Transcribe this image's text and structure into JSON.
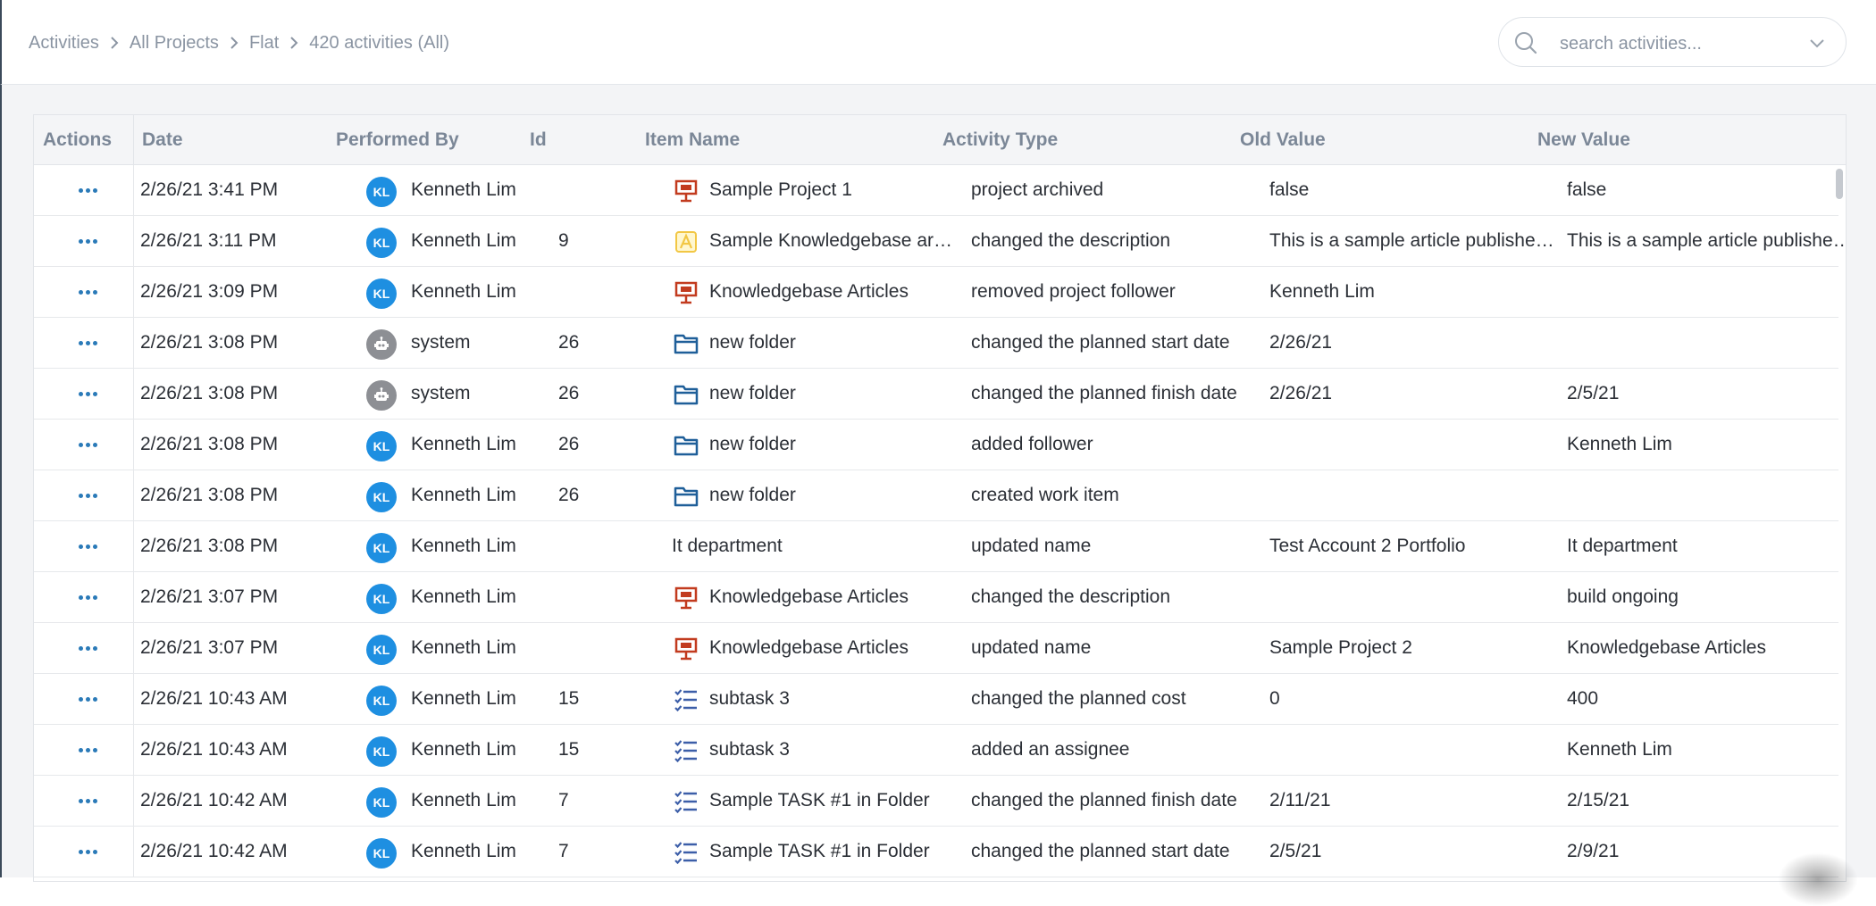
{
  "breadcrumb": {
    "items": [
      "Activities",
      "All Projects",
      "Flat"
    ],
    "current": "420 activities (All)"
  },
  "search": {
    "placeholder": "search activities..."
  },
  "table": {
    "headers": [
      "Actions",
      "Date",
      "Performed By",
      "Id",
      "Item Name",
      "Activity Type",
      "Old Value",
      "New Value"
    ],
    "rows": [
      {
        "date": "2/26/21 3:41 PM",
        "user": "Kenneth Lim",
        "avatar": "KL",
        "id": "",
        "icon": "project-icon",
        "item": "Sample Project 1",
        "type": "project archived",
        "old": "false",
        "new": "false"
      },
      {
        "date": "2/26/21 3:11 PM",
        "user": "Kenneth Lim",
        "avatar": "KL",
        "id": "9",
        "icon": "article-icon",
        "item": "Sample Knowledgebase ar…",
        "type": "changed the description",
        "old": "This is a sample article publishe…",
        "new": "This is a sample article published…"
      },
      {
        "date": "2/26/21 3:09 PM",
        "user": "Kenneth Lim",
        "avatar": "KL",
        "id": "",
        "icon": "project-icon",
        "item": "Knowledgebase Articles",
        "type": "removed project follower",
        "old": "Kenneth Lim",
        "new": ""
      },
      {
        "date": "2/26/21 3:08 PM",
        "user": "system",
        "avatar": "robot",
        "id": "26",
        "icon": "folder-icon",
        "item": "new folder",
        "type": "changed the planned start date",
        "old": "2/26/21",
        "new": ""
      },
      {
        "date": "2/26/21 3:08 PM",
        "user": "system",
        "avatar": "robot",
        "id": "26",
        "icon": "folder-icon",
        "item": "new folder",
        "type": "changed the planned finish date",
        "old": "2/26/21",
        "new": "2/5/21"
      },
      {
        "date": "2/26/21 3:08 PM",
        "user": "Kenneth Lim",
        "avatar": "KL",
        "id": "26",
        "icon": "folder-icon",
        "item": "new folder",
        "type": "added follower",
        "old": "",
        "new": "Kenneth Lim"
      },
      {
        "date": "2/26/21 3:08 PM",
        "user": "Kenneth Lim",
        "avatar": "KL",
        "id": "26",
        "icon": "folder-icon",
        "item": "new folder",
        "type": "created work item",
        "old": "",
        "new": ""
      },
      {
        "date": "2/26/21 3:08 PM",
        "user": "Kenneth Lim",
        "avatar": "KL",
        "id": "",
        "icon": "",
        "item": "It department",
        "type": "updated name",
        "old": "Test Account 2  Portfolio",
        "new": "It department"
      },
      {
        "date": "2/26/21 3:07 PM",
        "user": "Kenneth Lim",
        "avatar": "KL",
        "id": "",
        "icon": "project-icon",
        "item": "Knowledgebase Articles",
        "type": "changed the description",
        "old": "",
        "new": "build ongoing"
      },
      {
        "date": "2/26/21 3:07 PM",
        "user": "Kenneth Lim",
        "avatar": "KL",
        "id": "",
        "icon": "project-icon",
        "item": "Knowledgebase Articles",
        "type": "updated name",
        "old": "Sample Project 2",
        "new": "Knowledgebase Articles"
      },
      {
        "date": "2/26/21 10:43 AM",
        "user": "Kenneth Lim",
        "avatar": "KL",
        "id": "15",
        "icon": "task-list-icon",
        "item": "subtask 3",
        "type": "changed the planned cost",
        "old": "0",
        "new": "400"
      },
      {
        "date": "2/26/21 10:43 AM",
        "user": "Kenneth Lim",
        "avatar": "KL",
        "id": "15",
        "icon": "task-list-icon",
        "item": "subtask 3",
        "type": "added an assignee",
        "old": "",
        "new": "Kenneth Lim"
      },
      {
        "date": "2/26/21 10:42 AM",
        "user": "Kenneth Lim",
        "avatar": "KL",
        "id": "7",
        "icon": "task-list-icon",
        "item": "Sample TASK #1 in Folder",
        "type": "changed the planned finish date",
        "old": "2/11/21",
        "new": "2/15/21"
      },
      {
        "date": "2/26/21 10:42 AM",
        "user": "Kenneth Lim",
        "avatar": "KL",
        "id": "7",
        "icon": "task-list-icon",
        "item": "Sample TASK #1 in Folder",
        "type": "changed the planned start date",
        "old": "2/5/21",
        "new": "2/9/21"
      }
    ]
  },
  "colors": {
    "accent": "#2a7ab8",
    "avatar": "#1e8fe1",
    "system_avatar": "#8d8f94",
    "project_icon": "#c23b1f",
    "article_icon": "#f2c744",
    "folder_icon": "#1f5f99",
    "task_icon": "#3c5ea8"
  }
}
